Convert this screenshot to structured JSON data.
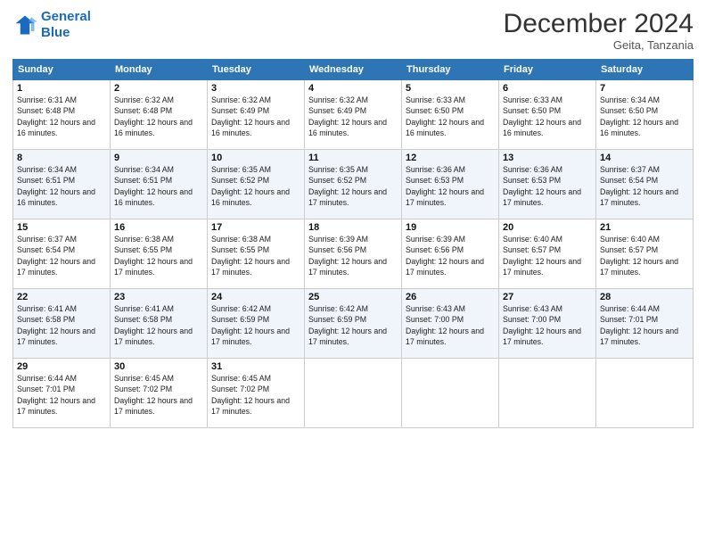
{
  "logo": {
    "line1": "General",
    "line2": "Blue"
  },
  "title": "December 2024",
  "subtitle": "Geita, Tanzania",
  "days_of_week": [
    "Sunday",
    "Monday",
    "Tuesday",
    "Wednesday",
    "Thursday",
    "Friday",
    "Saturday"
  ],
  "weeks": [
    [
      {
        "day": 1,
        "sunrise": "6:31 AM",
        "sunset": "6:48 PM",
        "daylight": "12 hours and 16 minutes"
      },
      {
        "day": 2,
        "sunrise": "6:32 AM",
        "sunset": "6:48 PM",
        "daylight": "12 hours and 16 minutes"
      },
      {
        "day": 3,
        "sunrise": "6:32 AM",
        "sunset": "6:49 PM",
        "daylight": "12 hours and 16 minutes"
      },
      {
        "day": 4,
        "sunrise": "6:32 AM",
        "sunset": "6:49 PM",
        "daylight": "12 hours and 16 minutes"
      },
      {
        "day": 5,
        "sunrise": "6:33 AM",
        "sunset": "6:50 PM",
        "daylight": "12 hours and 16 minutes"
      },
      {
        "day": 6,
        "sunrise": "6:33 AM",
        "sunset": "6:50 PM",
        "daylight": "12 hours and 16 minutes"
      },
      {
        "day": 7,
        "sunrise": "6:34 AM",
        "sunset": "6:50 PM",
        "daylight": "12 hours and 16 minutes"
      }
    ],
    [
      {
        "day": 8,
        "sunrise": "6:34 AM",
        "sunset": "6:51 PM",
        "daylight": "12 hours and 16 minutes"
      },
      {
        "day": 9,
        "sunrise": "6:34 AM",
        "sunset": "6:51 PM",
        "daylight": "12 hours and 16 minutes"
      },
      {
        "day": 10,
        "sunrise": "6:35 AM",
        "sunset": "6:52 PM",
        "daylight": "12 hours and 16 minutes"
      },
      {
        "day": 11,
        "sunrise": "6:35 AM",
        "sunset": "6:52 PM",
        "daylight": "12 hours and 17 minutes"
      },
      {
        "day": 12,
        "sunrise": "6:36 AM",
        "sunset": "6:53 PM",
        "daylight": "12 hours and 17 minutes"
      },
      {
        "day": 13,
        "sunrise": "6:36 AM",
        "sunset": "6:53 PM",
        "daylight": "12 hours and 17 minutes"
      },
      {
        "day": 14,
        "sunrise": "6:37 AM",
        "sunset": "6:54 PM",
        "daylight": "12 hours and 17 minutes"
      }
    ],
    [
      {
        "day": 15,
        "sunrise": "6:37 AM",
        "sunset": "6:54 PM",
        "daylight": "12 hours and 17 minutes"
      },
      {
        "day": 16,
        "sunrise": "6:38 AM",
        "sunset": "6:55 PM",
        "daylight": "12 hours and 17 minutes"
      },
      {
        "day": 17,
        "sunrise": "6:38 AM",
        "sunset": "6:55 PM",
        "daylight": "12 hours and 17 minutes"
      },
      {
        "day": 18,
        "sunrise": "6:39 AM",
        "sunset": "6:56 PM",
        "daylight": "12 hours and 17 minutes"
      },
      {
        "day": 19,
        "sunrise": "6:39 AM",
        "sunset": "6:56 PM",
        "daylight": "12 hours and 17 minutes"
      },
      {
        "day": 20,
        "sunrise": "6:40 AM",
        "sunset": "6:57 PM",
        "daylight": "12 hours and 17 minutes"
      },
      {
        "day": 21,
        "sunrise": "6:40 AM",
        "sunset": "6:57 PM",
        "daylight": "12 hours and 17 minutes"
      }
    ],
    [
      {
        "day": 22,
        "sunrise": "6:41 AM",
        "sunset": "6:58 PM",
        "daylight": "12 hours and 17 minutes"
      },
      {
        "day": 23,
        "sunrise": "6:41 AM",
        "sunset": "6:58 PM",
        "daylight": "12 hours and 17 minutes"
      },
      {
        "day": 24,
        "sunrise": "6:42 AM",
        "sunset": "6:59 PM",
        "daylight": "12 hours and 17 minutes"
      },
      {
        "day": 25,
        "sunrise": "6:42 AM",
        "sunset": "6:59 PM",
        "daylight": "12 hours and 17 minutes"
      },
      {
        "day": 26,
        "sunrise": "6:43 AM",
        "sunset": "7:00 PM",
        "daylight": "12 hours and 17 minutes"
      },
      {
        "day": 27,
        "sunrise": "6:43 AM",
        "sunset": "7:00 PM",
        "daylight": "12 hours and 17 minutes"
      },
      {
        "day": 28,
        "sunrise": "6:44 AM",
        "sunset": "7:01 PM",
        "daylight": "12 hours and 17 minutes"
      }
    ],
    [
      {
        "day": 29,
        "sunrise": "6:44 AM",
        "sunset": "7:01 PM",
        "daylight": "12 hours and 17 minutes"
      },
      {
        "day": 30,
        "sunrise": "6:45 AM",
        "sunset": "7:02 PM",
        "daylight": "12 hours and 17 minutes"
      },
      {
        "day": 31,
        "sunrise": "6:45 AM",
        "sunset": "7:02 PM",
        "daylight": "12 hours and 17 minutes"
      },
      null,
      null,
      null,
      null
    ]
  ]
}
